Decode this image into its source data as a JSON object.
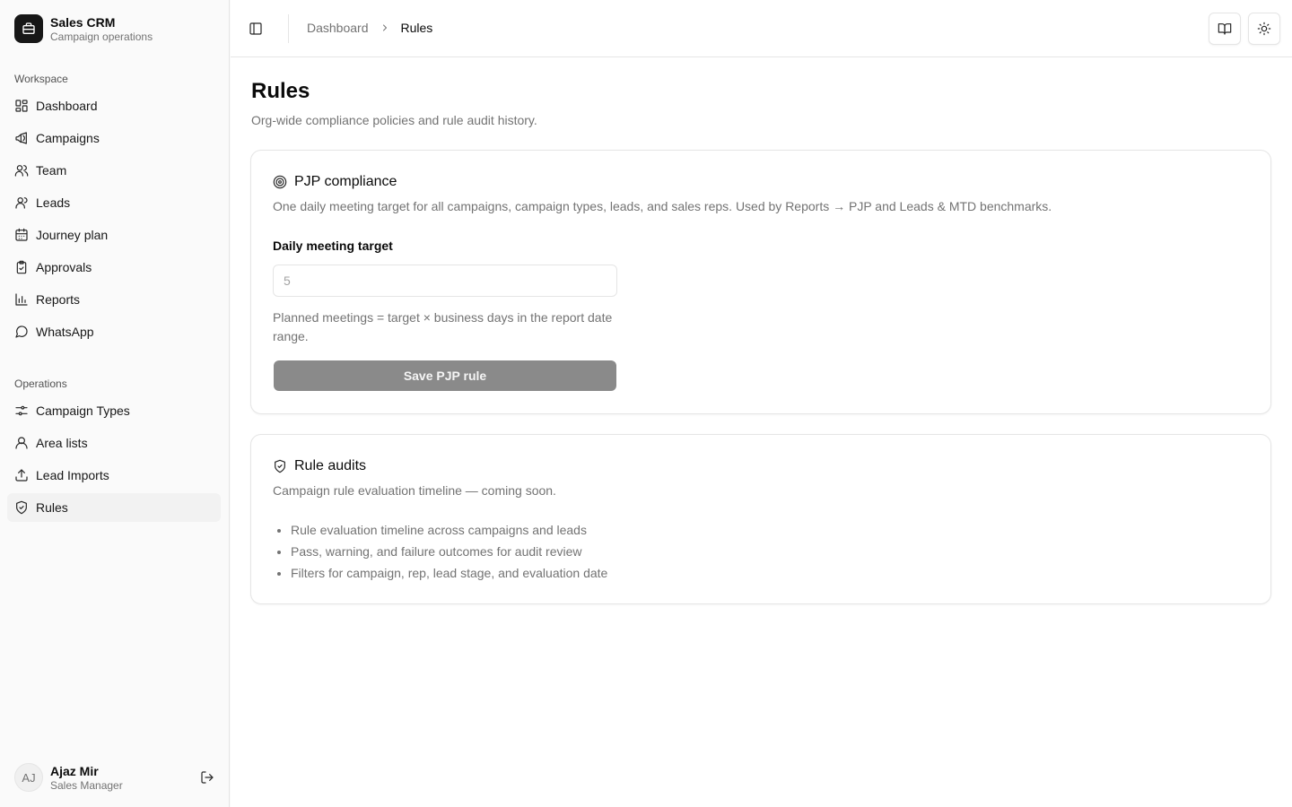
{
  "brand": {
    "title": "Sales CRM",
    "subtitle": "Campaign operations"
  },
  "sidebar": {
    "workspace_label": "Workspace",
    "workspace_items": [
      {
        "label": "Dashboard",
        "icon": "dashboard-icon"
      },
      {
        "label": "Campaigns",
        "icon": "megaphone-icon"
      },
      {
        "label": "Team",
        "icon": "users-icon"
      },
      {
        "label": "Leads",
        "icon": "user-icon"
      },
      {
        "label": "Journey plan",
        "icon": "calendar-icon"
      },
      {
        "label": "Approvals",
        "icon": "clipboard-check-icon"
      },
      {
        "label": "Reports",
        "icon": "bar-chart-icon"
      },
      {
        "label": "WhatsApp",
        "icon": "message-circle-icon"
      }
    ],
    "operations_label": "Operations",
    "operations_items": [
      {
        "label": "Campaign Types",
        "icon": "sliders-icon"
      },
      {
        "label": "Area lists",
        "icon": "user-round-icon"
      },
      {
        "label": "Lead Imports",
        "icon": "upload-icon"
      },
      {
        "label": "Rules",
        "icon": "shield-check-icon",
        "active": true
      }
    ]
  },
  "user": {
    "initials": "AJ",
    "name": "Ajaz Mir",
    "role": "Sales Manager"
  },
  "topbar": {
    "breadcrumb": [
      "Dashboard",
      "Rules"
    ]
  },
  "page": {
    "title": "Rules",
    "subtitle": "Org-wide compliance policies and rule audit history."
  },
  "pjp": {
    "title": "PJP compliance",
    "description": "One daily meeting target for all campaigns, campaign types, leads, and sales reps. Used by Reports → PJP and Leads & MTD benchmarks.",
    "field_label": "Daily meeting target",
    "field_placeholder": "5",
    "help": "Planned meetings = target × business days in the report date range.",
    "save_label": "Save PJP rule"
  },
  "audits": {
    "title": "Rule audits",
    "description": "Campaign rule evaluation timeline — coming soon.",
    "items": [
      "Rule evaluation timeline across campaigns and leads",
      "Pass, warning, and failure outcomes for audit review",
      "Filters for campaign, rep, lead stage, and evaluation date"
    ]
  },
  "colors": {
    "accent": "#171717",
    "muted": "#737373",
    "border": "#e5e5e5",
    "disabled_button": "#8a8a8a"
  }
}
